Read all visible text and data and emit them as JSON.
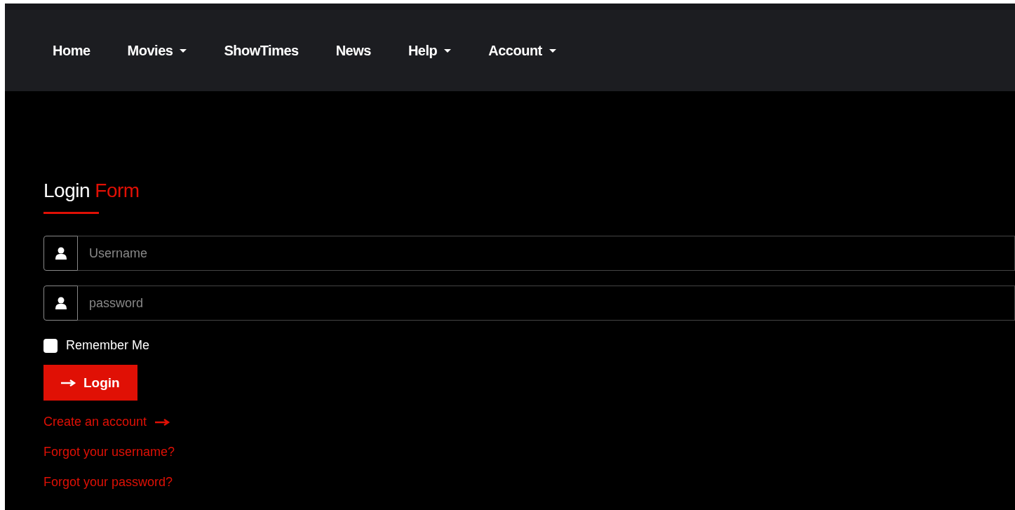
{
  "nav": [
    {
      "label": "Home",
      "dropdown": false
    },
    {
      "label": "Movies",
      "dropdown": true
    },
    {
      "label": "ShowTimes",
      "dropdown": false
    },
    {
      "label": "News",
      "dropdown": false
    },
    {
      "label": "Help",
      "dropdown": true
    },
    {
      "label": "Account",
      "dropdown": true
    }
  ],
  "form": {
    "title": "Login",
    "title_accent": "Form",
    "fields": [
      {
        "placeholder": "Username"
      },
      {
        "placeholder": "password"
      }
    ],
    "remember": {
      "label": "Remember Me",
      "checked": false
    },
    "submit": "Login",
    "links": [
      {
        "label": "Create an account",
        "kind": "arrow"
      },
      {
        "label": "Forgot your username?",
        "kind": "plain"
      },
      {
        "label": "Forgot your password?",
        "kind": "plain"
      }
    ]
  }
}
